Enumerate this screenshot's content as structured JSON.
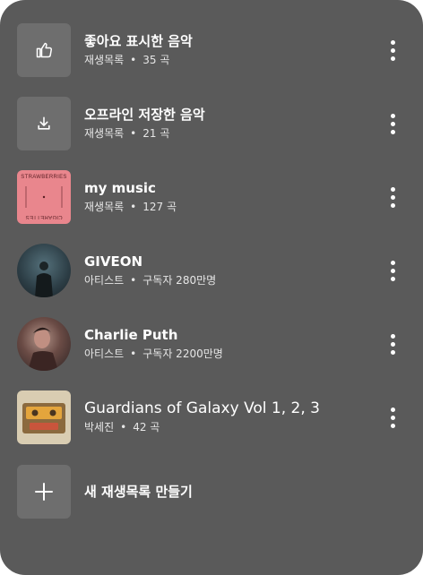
{
  "items": [
    {
      "title": "좋아요 표시한 음악",
      "type": "재생목록",
      "count": "35 곡",
      "icon": "thumbs-up-icon"
    },
    {
      "title": "오프라인 저장한 음악",
      "type": "재생목록",
      "count": "21 곡",
      "icon": "download-icon"
    },
    {
      "title": "my music",
      "type": "재생목록",
      "count": "127 곡",
      "art_top": "STRAWBERRIES",
      "art_bottom": "CIGARETTES"
    },
    {
      "title": "GIVEON",
      "type": "아티스트",
      "count": "구독자 280만명"
    },
    {
      "title": "Charlie Puth",
      "type": "아티스트",
      "count": "구독자 2200만명"
    },
    {
      "title": "Guardians of Galaxy Vol 1, 2, 3",
      "type": "박세진",
      "count": "42 곡"
    }
  ],
  "new_playlist": {
    "label": "새 재생목록 만들기",
    "icon": "plus-icon"
  },
  "separator": "•",
  "colors": {
    "panel": "#5a5a5a",
    "tile": "#6e6e6e",
    "text": "#ffffff"
  }
}
